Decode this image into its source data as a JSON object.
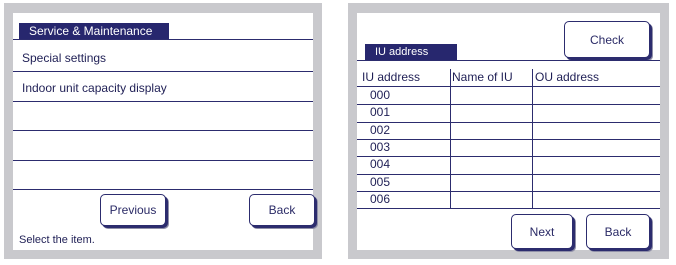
{
  "left_screen": {
    "title": "Service & Maintenance",
    "menu_items": [
      "Special settings",
      "Indoor unit capacity display"
    ],
    "previous_label": "Previous",
    "back_label": "Back",
    "status_text": "Select the item."
  },
  "right_screen": {
    "title": "IU address",
    "check_label": "Check",
    "columns": [
      "IU address",
      "Name of IU",
      "OU address"
    ],
    "rows": [
      {
        "iu_address": "000",
        "name_of_iu": "",
        "ou_address": ""
      },
      {
        "iu_address": "001",
        "name_of_iu": "",
        "ou_address": ""
      },
      {
        "iu_address": "002",
        "name_of_iu": "",
        "ou_address": ""
      },
      {
        "iu_address": "003",
        "name_of_iu": "",
        "ou_address": ""
      },
      {
        "iu_address": "004",
        "name_of_iu": "",
        "ou_address": ""
      },
      {
        "iu_address": "005",
        "name_of_iu": "",
        "ou_address": ""
      },
      {
        "iu_address": "006",
        "name_of_iu": "",
        "ou_address": ""
      }
    ],
    "next_label": "Next",
    "back_label": "Back"
  }
}
